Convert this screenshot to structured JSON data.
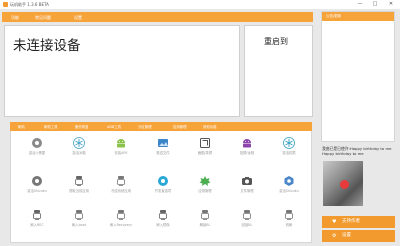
{
  "window": {
    "title": "玩机助手 1.3.6 BETA",
    "min": "—",
    "max": "□",
    "close": "✕"
  },
  "menu": [
    "功能",
    "常见问题",
    "设置"
  ],
  "status": {
    "connection": "未连接设备"
  },
  "reboot": {
    "title": "重启到"
  },
  "tabs": [
    "刷机",
    "刷机工具",
    "备份恢复",
    "ADB工具",
    "分区管理",
    "应用管理",
    "其他功能"
  ],
  "tools": [
    {
      "label": "激活小黑屋",
      "icon": "gear-icon",
      "color": "#8a8a8a"
    },
    {
      "label": "激活冰箱",
      "icon": "snowflake-icon",
      "color": "#4aa3c8"
    },
    {
      "label": "安装APK",
      "icon": "android-icon",
      "color": "#8bc34a"
    },
    {
      "label": "推送文件",
      "icon": "image-icon",
      "color": "#3a86c8"
    },
    {
      "label": "截图/录屏",
      "icon": "crop-icon",
      "color": "#555555"
    },
    {
      "label": "投屏/远程",
      "icon": "android-icon",
      "color": "#8e44ad"
    },
    {
      "label": "激活权限",
      "icon": "snowflake-icon",
      "color": "#39a0c0"
    },
    {
      "label": "激活Shizuku",
      "icon": "gear-icon",
      "color": "#777777"
    },
    {
      "label": "提取当前应用",
      "icon": "robot-icon",
      "color": "#666666"
    },
    {
      "label": "冻结系统应用",
      "icon": "robot-icon",
      "color": "#777777"
    },
    {
      "label": "开发者选项",
      "icon": "gear-icon",
      "color": "#29a8d8"
    },
    {
      "label": "应用管理",
      "icon": "leaf-icon",
      "color": "#4caf50"
    },
    {
      "label": "文件管理",
      "icon": "camera-icon",
      "color": "#555555"
    },
    {
      "label": "激活Shizuku",
      "icon": "hexagon-icon",
      "color": "#4a86c8"
    },
    {
      "label": "刷入REC",
      "icon": "robot-icon",
      "color": "#666666"
    },
    {
      "label": "刷入boot",
      "icon": "robot-icon",
      "color": "#777777"
    },
    {
      "label": "刷入Recovery",
      "icon": "robot-icon",
      "color": "#777777"
    },
    {
      "label": "刷入镜像",
      "icon": "robot-icon",
      "color": "#666666"
    },
    {
      "label": "解锁BL",
      "icon": "robot-icon",
      "color": "#777777"
    },
    {
      "label": "回锁BL",
      "icon": "robot-icon",
      "color": "#777777"
    },
    {
      "label": "线刷",
      "icon": "robot-icon",
      "color": "#777777"
    }
  ],
  "sidebar": {
    "title": "公告/更新"
  },
  "message": "我曲已是日使许:Happy birthday to me Happy birthday to me",
  "buttons": {
    "support": "支持作者",
    "settings": "设置"
  }
}
